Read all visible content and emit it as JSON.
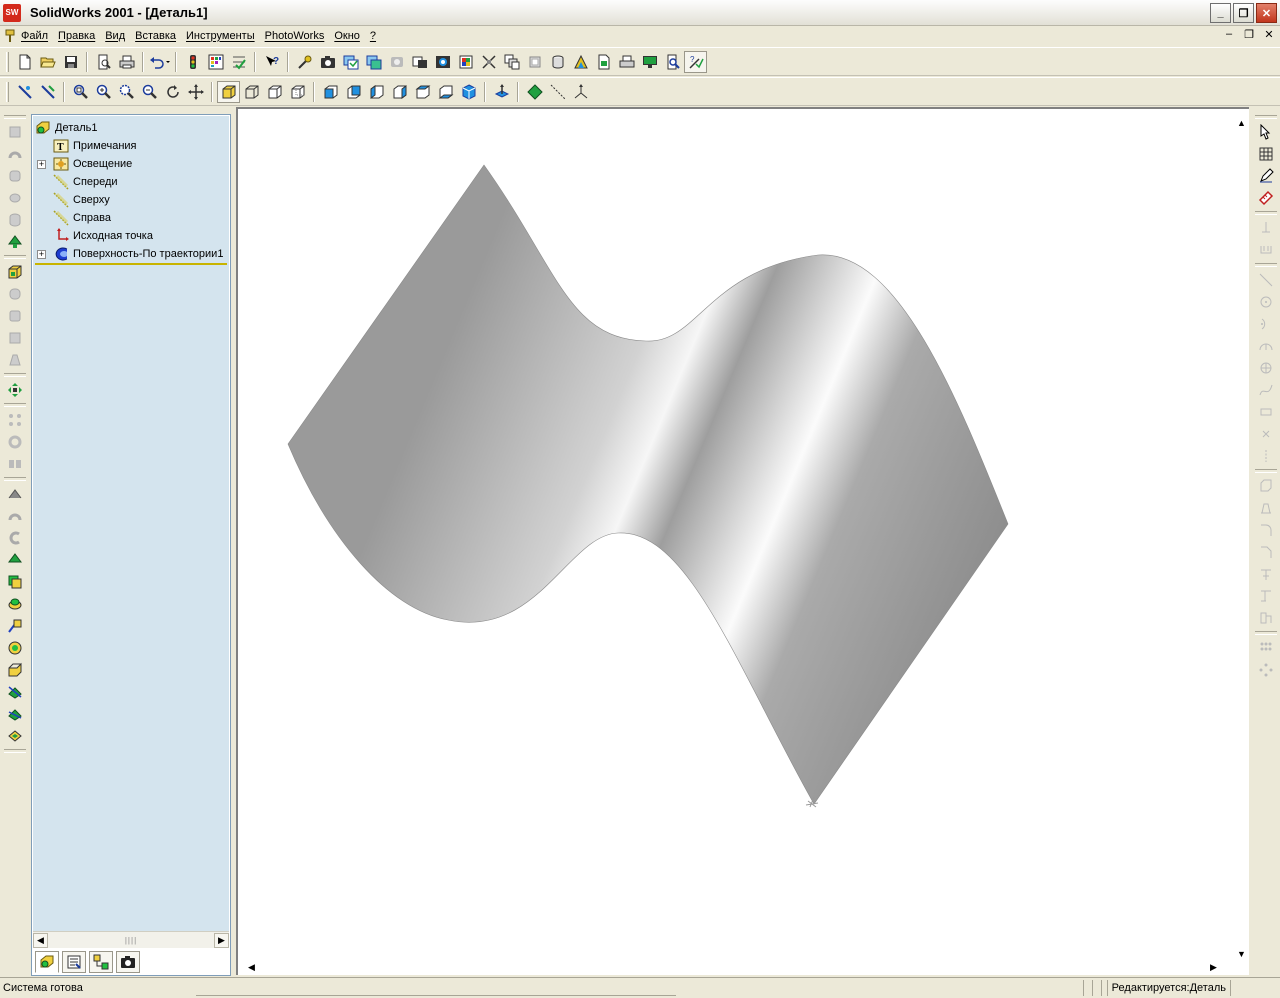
{
  "window": {
    "app_logo": "SW",
    "title": "SolidWorks 2001 - [Деталь1]",
    "buttons": [
      "_",
      "❐",
      "✕"
    ]
  },
  "menu": {
    "items": [
      "Файл",
      "Правка",
      "Вид",
      "Вставка",
      "Инструменты",
      "PhotoWorks",
      "Окно",
      "?"
    ],
    "mdi_buttons": [
      "–",
      "❐",
      "✕"
    ]
  },
  "toolbar1": {
    "icons": [
      "new-document-icon",
      "open-folder-icon",
      "save-icon",
      "print-preview-icon",
      "print-icon",
      "undo-icon",
      "traffic-light-icon",
      "grid-icon",
      "options-icon",
      "help-icon",
      "photoworks-wizard-icon",
      "camera-icon",
      "render-icon",
      "render-area-icon",
      "render-last-icon",
      "material-icon",
      "lighting-icon",
      "scene-icon",
      "decal-icon",
      "texture-icon",
      "cylinder-icon",
      "map-icon",
      "render-file-icon",
      "print-render-icon",
      "monitor-icon",
      "zoom-doc-icon",
      "whats-this-icon"
    ]
  },
  "toolbar2": {
    "icons": [
      "sketch-line-icon",
      "sketch-spline-icon",
      "zoom-fit-icon",
      "zoom-in-icon",
      "zoom-area-icon",
      "zoom-out-icon",
      "rotate-icon",
      "pan-icon",
      "shaded-cube-icon",
      "wireframe-cube-icon",
      "hidden-lines-icon",
      "hidden-gray-icon",
      "view-front-icon",
      "view-back-icon",
      "view-left-icon",
      "view-right-icon",
      "view-top-icon",
      "view-bottom-icon",
      "view-iso-icon",
      "normal-to-icon",
      "plane-icon",
      "axis-icon",
      "coordinate-icon"
    ]
  },
  "tree": {
    "items": [
      {
        "label": "Деталь1",
        "icon": "part-icon",
        "indent": 0
      },
      {
        "label": "Примечания",
        "icon": "notes-icon",
        "indent": 1
      },
      {
        "label": "Освещение",
        "icon": "lighting-icon",
        "indent": 1,
        "expandable": true
      },
      {
        "label": "Спереди",
        "icon": "plane-icon",
        "indent": 1
      },
      {
        "label": "Сверху",
        "icon": "plane-icon",
        "indent": 1
      },
      {
        "label": "Справа",
        "icon": "plane-icon",
        "indent": 1
      },
      {
        "label": "Исходная точка",
        "icon": "origin-icon",
        "indent": 1
      },
      {
        "label": "Поверхность-По траектории1",
        "icon": "surface-sweep-icon",
        "indent": 1,
        "expandable": true
      }
    ],
    "scroll_left": "◀",
    "scroll_right": "▶",
    "scroll_thumb": "||||",
    "tabs": [
      "feature-manager-tab-icon",
      "property-manager-tab-icon",
      "configuration-tab-icon",
      "photoworks-tab-icon"
    ]
  },
  "viewport": {
    "scroll_up": "▲",
    "scroll_down": "▼",
    "scroll_left": "◀",
    "scroll_right": "▶"
  },
  "status": {
    "text": "Система готова",
    "mode": "Редактируется:Деталь"
  }
}
